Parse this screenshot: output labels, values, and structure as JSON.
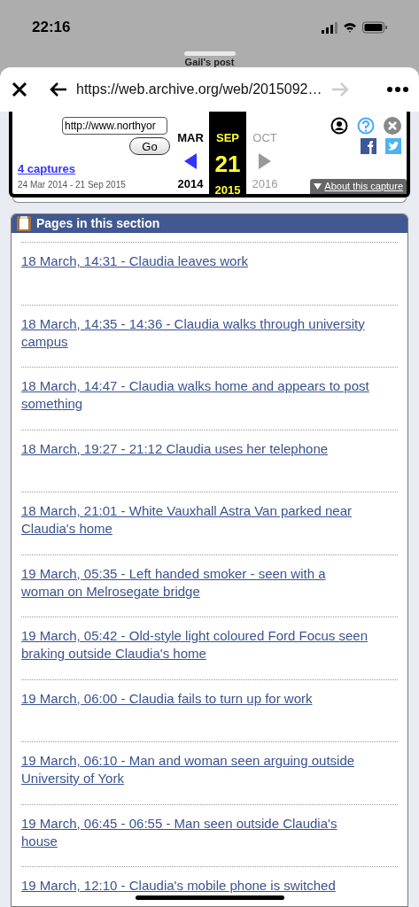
{
  "status_bar": {
    "time": "22:16"
  },
  "sheet": {
    "title": "Gail's post"
  },
  "browser": {
    "url": "https://web.archive.org/web/2015092…"
  },
  "wayback": {
    "url_field": "http://www.northyor",
    "go": "Go",
    "captures": "4 captures",
    "range": "24 Mar 2014 - 21 Sep 2015",
    "months": [
      {
        "month": "MAR",
        "year": "2014",
        "selected": false
      },
      {
        "month": "SEP",
        "day": "21",
        "year": "2015",
        "selected": true
      },
      {
        "month": "OCT",
        "year": "2016",
        "selected": false
      }
    ],
    "about": "About this capture"
  },
  "section": {
    "title": "Pages in this section",
    "links": [
      "18 March, 14:31 - Claudia leaves work",
      "18 March, 14:35 - 14:36 - Claudia walks through university campus",
      "18 March, 14:47 - Claudia walks home and appears to post something",
      "18 March, 19:27 - 21:12 Claudia uses her telephone",
      "18 March, 21:01 - White Vauxhall Astra Van parked near Claudia's home",
      "19 March, 05:35 - Left handed smoker - seen with a woman on Melrosegate bridge",
      "19 March, 05:42 - Old-style light coloured Ford Focus seen braking outside Claudia's home",
      "19 March, 06:00 - Claudia fails to turn up for work",
      "19 March, 06:10 - Man and woman seen arguing outside University of York",
      "19 March, 06:45 - 06:55 - Man seen outside Claudia's house",
      "19 March, 12:10 - Claudia's mobile phone is switched"
    ]
  }
}
